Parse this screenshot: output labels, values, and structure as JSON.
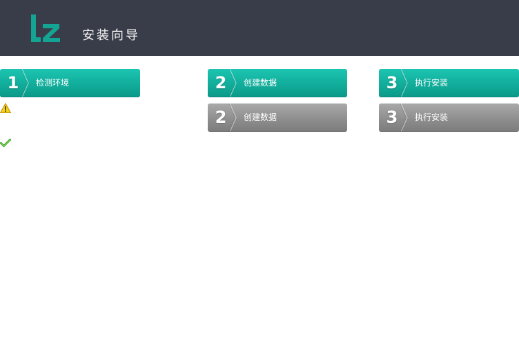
{
  "header": {
    "logo_text": "lz",
    "title": "安装向导"
  },
  "steps": [
    {
      "number": "1",
      "label": "检测环境",
      "state": "active"
    },
    {
      "number": "2",
      "label": "创建数据",
      "state": "active"
    },
    {
      "number": "3",
      "label": "执行安装",
      "state": "active"
    },
    {
      "number": "2",
      "label": "创建数据",
      "state": "inactive"
    },
    {
      "number": "3",
      "label": "执行安装",
      "state": "inactive"
    }
  ],
  "status_icons": [
    {
      "icon": "warning-icon"
    },
    {
      "icon": "check-icon"
    }
  ],
  "colors": {
    "header_bg": "#393d49",
    "accent": "#12ad9c",
    "inactive": "#8f8f8f"
  }
}
